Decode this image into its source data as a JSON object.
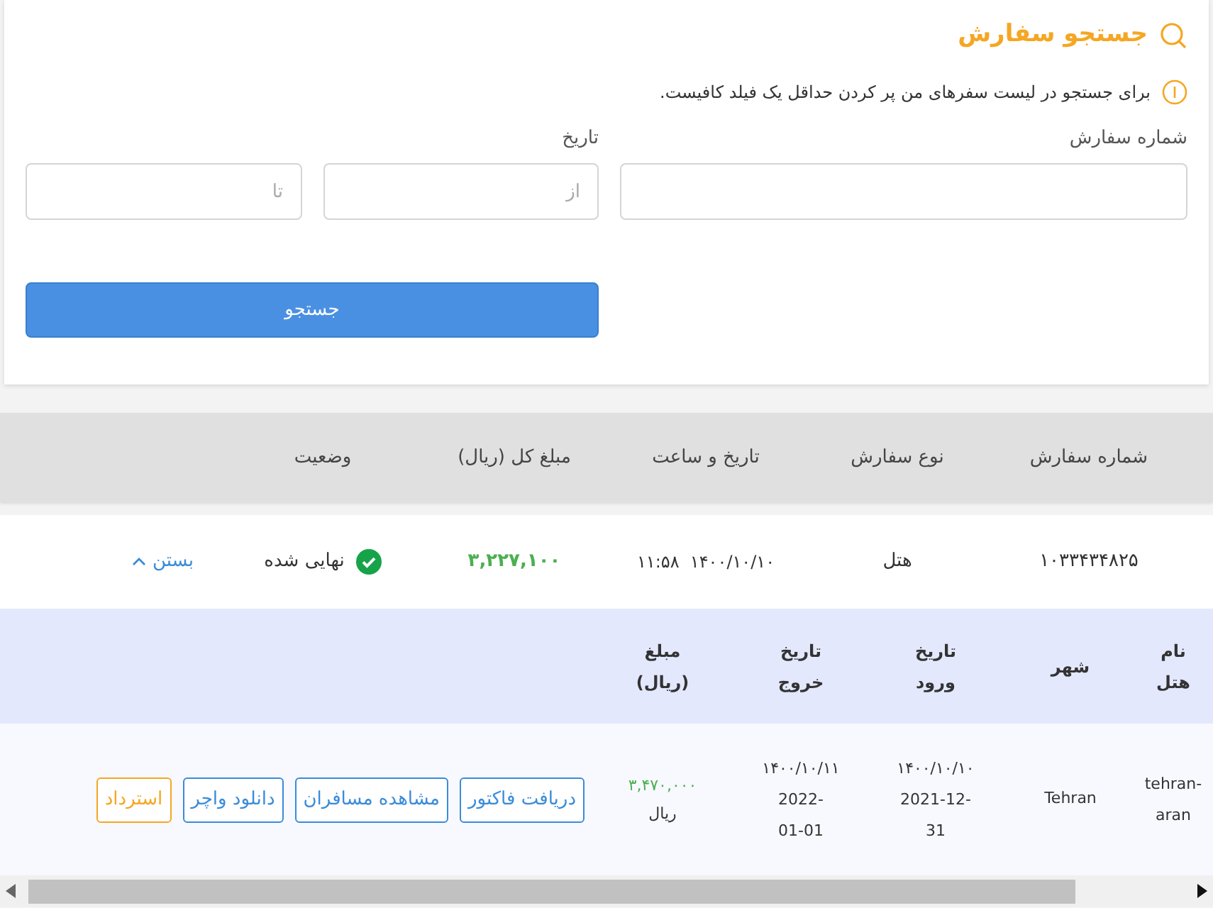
{
  "search_panel": {
    "title": "جستجو سفارش",
    "hint": "برای جستجو در لیست سفرهای من پر کردن حداقل یک فیلد کافیست.",
    "fields": [
      {
        "label": "شماره سفارش"
      },
      {
        "label": "تاریخ",
        "inputs": [
          {
            "placeholder": "از"
          },
          {
            "placeholder": "تا"
          }
        ]
      }
    ],
    "button": "جستجو"
  },
  "orders_table": {
    "columns": [
      "شماره سفارش",
      "نوع سفارش",
      "تاریخ و ساعت",
      "مبلغ کل (ریال)",
      "وضعیت"
    ],
    "rows": [
      {
        "order_number": "۱۰۳۳۴۳۴۸۲۵",
        "type": "هتل",
        "datetime": "۱۴۰۰/۱۰/۱۰  ۱۱:۵۸",
        "total": "۳,۲۲۷,۱۰۰",
        "status": {
          "text": "نهایی شده",
          "kind": "final"
        },
        "toggle": "بستن",
        "expanded": true,
        "details": {
          "columns": [
            "نام هتل",
            "شهر",
            "تاریخ ورود",
            "تاریخ خروج",
            "مبلغ (ریال)"
          ],
          "rows": [
            {
              "hotel": "tehran-aran",
              "city": "Tehran",
              "checkin": [
                "۱۴۰۰/۱۰/۱۰",
                "2021-12-31"
              ],
              "checkout": [
                "۱۴۰۰/۱۰/۱۱",
                "2022-01-01"
              ],
              "amount": "۳,۴۷۰,۰۰۰",
              "currency": "ریال",
              "actions": [
                {
                  "label": "دریافت فاکتور",
                  "kind": "primary"
                },
                {
                  "label": "مشاهده مسافران",
                  "kind": "primary"
                },
                {
                  "label": "دانلود واچر",
                  "kind": "primary"
                },
                {
                  "label": "استرداد",
                  "kind": "warning"
                }
              ]
            }
          ]
        }
      }
    ]
  }
}
